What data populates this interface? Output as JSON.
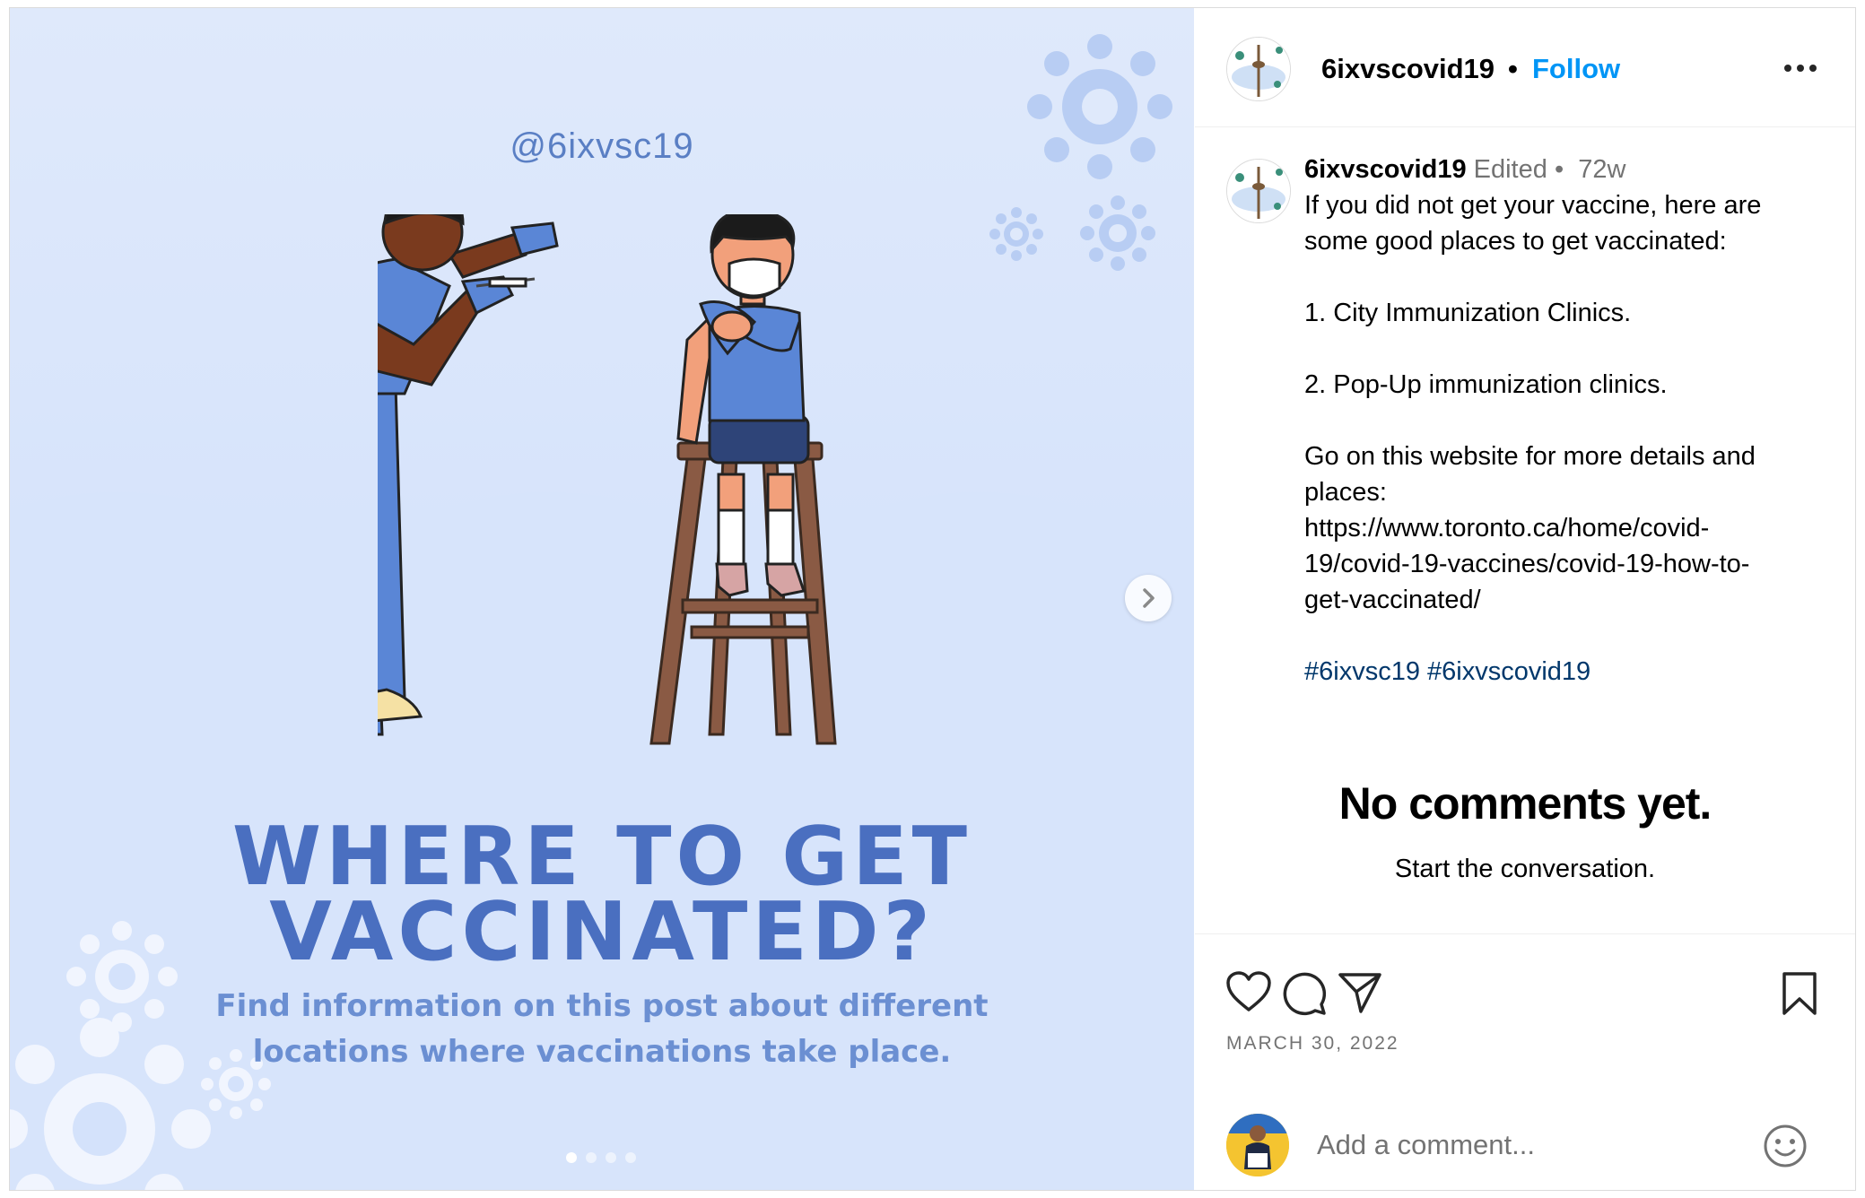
{
  "media": {
    "handle": "@6ixvsc19",
    "headline_line1": "WHERE TO GET",
    "headline_line2": "VACCINATED?",
    "subline_line1": "Find information on this post about different",
    "subline_line2": "locations where vaccinations take place.",
    "carousel_count": 4,
    "carousel_active": 1,
    "illustration": "nurse-vaccinating-child-icon",
    "colors": {
      "background": "#dfe9fb",
      "headline": "#4a6fc0",
      "scrubs": "#5a86d6"
    }
  },
  "post_header": {
    "username": "6ixvscovid19",
    "separator": "•",
    "follow_label": "Follow",
    "more_icon": "more-options-icon"
  },
  "caption": {
    "username": "6ixvscovid19",
    "edited_label": "Edited",
    "dot": "•",
    "age": "72w",
    "lines": [
      "If you did not get your vaccine, here are",
      "some good places to get vaccinated:",
      "",
      "1. City Immunization Clinics.",
      "",
      "2. Pop-Up immunization clinics.",
      "",
      "Go on this website for more details and",
      "places:",
      "https://www.toronto.ca/home/covid-",
      "19/covid-19-vaccines/covid-19-how-to-",
      "get-vaccinated/",
      ""
    ],
    "hashtags": [
      "#6ixvsc19",
      "#6ixvscovid19"
    ]
  },
  "comments": {
    "empty_title": "No comments yet.",
    "empty_subtitle": "Start the conversation."
  },
  "actions": {
    "icons": [
      "heart-icon",
      "comment-icon",
      "share-icon",
      "bookmark-icon"
    ],
    "date": "MARCH 30, 2022"
  },
  "comment_box": {
    "placeholder": "Add a comment...",
    "emoji_icon": "emoji-icon"
  },
  "colors": {
    "link": "#0095f6",
    "hashtag": "#00376b",
    "muted": "#737373"
  }
}
